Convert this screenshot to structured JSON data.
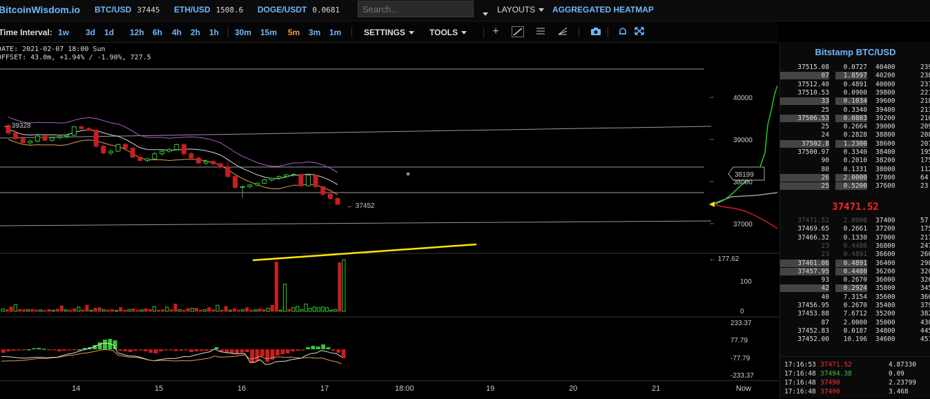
{
  "header": {
    "brand": "BitcoinWisdom.io",
    "tickers": [
      {
        "symbol": "BTC/USD",
        "value": "37445"
      },
      {
        "symbol": "ETH/USD",
        "value": "1508.6"
      },
      {
        "symbol": "DOGE/USDT",
        "value": "0.0681"
      }
    ],
    "search_placeholder": "Search...",
    "layouts_label": "LAYOUTS",
    "heatmap_label": "AGGREGATED HEATMAP"
  },
  "toolbar": {
    "time_interval_label": "Time Interval:",
    "intervals": [
      {
        "label": "1w",
        "active": false
      },
      {
        "label": "3d",
        "active": false
      },
      {
        "label": "1d",
        "active": false
      },
      {
        "label": "12h",
        "active": false
      },
      {
        "label": "6h",
        "active": false
      },
      {
        "label": "4h",
        "active": false
      },
      {
        "label": "2h",
        "active": false
      },
      {
        "label": "1h",
        "active": false
      },
      {
        "label": "30m",
        "active": false
      },
      {
        "label": "15m",
        "active": false
      },
      {
        "label": "5m",
        "active": true
      },
      {
        "label": "3m",
        "active": false
      },
      {
        "label": "1m",
        "active": false
      }
    ],
    "settings_label": "SETTINGS",
    "tools_label": "TOOLS"
  },
  "info": {
    "date_line": "DATE: 2021-02-07 18:00 Sun",
    "offset_line": "OFFSET: 43.0m, +1.94% / -1.90%, 727.5"
  },
  "chart_data": {
    "type": "candlestick",
    "price_axis_ticks": [
      "40000",
      "39000",
      "38000",
      "37000"
    ],
    "annotations": {
      "high_marker": "39328",
      "last_marker": "37452",
      "depth_price_box": "38199",
      "volume_peak": "177.62"
    },
    "volume_axis_ticks": [
      "100",
      "0"
    ],
    "macd_axis_ticks": [
      "233.37",
      "77.79",
      "-77.79",
      "-233.37"
    ],
    "x_axis_labels": [
      "14",
      "15",
      "16",
      "17",
      "18:00",
      "19",
      "20",
      "21",
      "Now"
    ],
    "candles": [
      {
        "o": 39330,
        "h": 39380,
        "l": 39120,
        "c": 39150
      },
      {
        "o": 39150,
        "h": 39220,
        "l": 38980,
        "c": 39020
      },
      {
        "o": 39020,
        "h": 39080,
        "l": 38880,
        "c": 38920
      },
      {
        "o": 38920,
        "h": 39000,
        "l": 38850,
        "c": 38960
      },
      {
        "o": 38960,
        "h": 39120,
        "l": 38930,
        "c": 39080
      },
      {
        "o": 39080,
        "h": 39150,
        "l": 38950,
        "c": 38980
      },
      {
        "o": 38980,
        "h": 39060,
        "l": 38940,
        "c": 39040
      },
      {
        "o": 39040,
        "h": 39100,
        "l": 39000,
        "c": 39070
      },
      {
        "o": 39070,
        "h": 39120,
        "l": 39020,
        "c": 39100
      },
      {
        "o": 39100,
        "h": 39320,
        "l": 39080,
        "c": 39300
      },
      {
        "o": 39300,
        "h": 39340,
        "l": 39220,
        "c": 39260
      },
      {
        "o": 39260,
        "h": 39300,
        "l": 39200,
        "c": 39220
      },
      {
        "o": 39220,
        "h": 39240,
        "l": 38800,
        "c": 38840
      },
      {
        "o": 38840,
        "h": 38880,
        "l": 38640,
        "c": 38680
      },
      {
        "o": 38680,
        "h": 38760,
        "l": 38620,
        "c": 38720
      },
      {
        "o": 38720,
        "h": 38900,
        "l": 38700,
        "c": 38880
      },
      {
        "o": 38880,
        "h": 38920,
        "l": 38760,
        "c": 38790
      },
      {
        "o": 38790,
        "h": 38820,
        "l": 38560,
        "c": 38580
      },
      {
        "o": 38580,
        "h": 38640,
        "l": 38480,
        "c": 38500
      },
      {
        "o": 38500,
        "h": 38560,
        "l": 38460,
        "c": 38540
      },
      {
        "o": 38540,
        "h": 38700,
        "l": 38520,
        "c": 38660
      },
      {
        "o": 38660,
        "h": 38760,
        "l": 38620,
        "c": 38720
      },
      {
        "o": 38720,
        "h": 38800,
        "l": 38680,
        "c": 38760
      },
      {
        "o": 38760,
        "h": 38900,
        "l": 38740,
        "c": 38880
      },
      {
        "o": 38880,
        "h": 38900,
        "l": 38620,
        "c": 38660
      },
      {
        "o": 38660,
        "h": 38700,
        "l": 38520,
        "c": 38560
      },
      {
        "o": 38560,
        "h": 38600,
        "l": 38420,
        "c": 38440
      },
      {
        "o": 38440,
        "h": 38520,
        "l": 38400,
        "c": 38480
      },
      {
        "o": 38480,
        "h": 38520,
        "l": 38380,
        "c": 38420
      },
      {
        "o": 38420,
        "h": 38460,
        "l": 38300,
        "c": 38340
      },
      {
        "o": 38340,
        "h": 38480,
        "l": 38080,
        "c": 38120
      },
      {
        "o": 38120,
        "h": 38160,
        "l": 37820,
        "c": 37860
      },
      {
        "o": 37860,
        "h": 37900,
        "l": 37620,
        "c": 37880
      },
      {
        "o": 37880,
        "h": 37940,
        "l": 37840,
        "c": 37920
      },
      {
        "o": 37920,
        "h": 37980,
        "l": 37880,
        "c": 37960
      },
      {
        "o": 37960,
        "h": 38060,
        "l": 37940,
        "c": 38040
      },
      {
        "o": 38040,
        "h": 38100,
        "l": 38000,
        "c": 38080
      },
      {
        "o": 38080,
        "h": 38140,
        "l": 38040,
        "c": 38120
      },
      {
        "o": 38120,
        "h": 38180,
        "l": 38080,
        "c": 38160
      },
      {
        "o": 38160,
        "h": 38200,
        "l": 38120,
        "c": 38170
      },
      {
        "o": 38170,
        "h": 38180,
        "l": 37860,
        "c": 37900
      },
      {
        "o": 37900,
        "h": 38180,
        "l": 37880,
        "c": 38150
      },
      {
        "o": 38150,
        "h": 38160,
        "l": 37840,
        "c": 37880
      },
      {
        "o": 37880,
        "h": 37900,
        "l": 37660,
        "c": 37700
      },
      {
        "o": 37700,
        "h": 37720,
        "l": 37560,
        "c": 37600
      },
      {
        "o": 37600,
        "h": 37620,
        "l": 37440,
        "c": 37460
      }
    ],
    "volume": [
      8,
      5,
      14,
      22,
      6,
      5,
      6,
      6,
      4,
      5,
      3,
      6,
      4,
      7,
      18,
      5,
      4,
      8,
      14,
      5,
      20,
      4,
      10,
      12,
      6,
      4,
      6,
      3,
      12,
      4,
      6,
      8,
      4,
      5,
      8,
      6,
      16,
      4,
      5,
      14,
      5,
      24,
      6,
      4,
      9,
      10,
      10,
      4,
      6,
      12,
      5,
      20,
      4,
      16,
      4,
      8,
      4,
      6,
      12,
      4,
      5,
      8,
      6,
      10,
      20,
      162,
      4,
      90,
      6,
      12,
      16,
      6,
      24,
      10,
      14,
      12,
      14,
      12,
      4,
      6,
      160,
      170
    ],
    "macd_hist": [
      -10,
      -6,
      -4,
      -3,
      -2,
      0,
      3,
      4,
      2,
      -2,
      -3,
      -6,
      -4,
      -2,
      -3,
      0,
      4,
      6,
      12,
      20,
      28,
      30,
      26,
      -4,
      -6,
      -8,
      -4,
      -3,
      -6,
      -10,
      -12,
      -6,
      -3,
      -2,
      -5,
      -4,
      -3,
      -8,
      -6,
      -5,
      -4,
      -3,
      6,
      -6,
      -10,
      -12,
      -14,
      -10,
      -8,
      -40,
      -34,
      -20,
      -36,
      -30,
      -18,
      -14,
      -12,
      -6,
      -4,
      -3,
      6,
      10,
      8,
      14,
      6,
      -4,
      -10,
      -26
    ]
  },
  "orderbook": {
    "title": "Bitstamp BTC/USD",
    "mid_price": "37471.52",
    "asks": [
      {
        "price": "37515.08",
        "amount": "0.0727",
        "level": "40400",
        "cum": "239"
      },
      {
        "price": "07",
        "amount": "1.8597",
        "level": "40200",
        "cum": "238",
        "hl": true
      },
      {
        "price": "37512.40",
        "amount": "0.4891",
        "level": "40000",
        "cum": "237"
      },
      {
        "price": "37510.53",
        "amount": "0.0900",
        "level": "39800",
        "cum": "221"
      },
      {
        "price": "33",
        "amount": "0.1034",
        "level": "39600",
        "cum": "218",
        "hl": true
      },
      {
        "price": "25",
        "amount": "0.3340",
        "level": "39400",
        "cum": "213"
      },
      {
        "price": "37506.53",
        "amount": "0.0803",
        "level": "39200",
        "cum": "210",
        "hl": true
      },
      {
        "price": "25",
        "amount": "0.2664",
        "level": "39000",
        "cum": "209"
      },
      {
        "price": "24",
        "amount": "0.2828",
        "level": "38800",
        "cum": "208"
      },
      {
        "price": "37502.8",
        "amount": "1.2300",
        "level": "38600",
        "cum": "207",
        "hl": true
      },
      {
        "price": "37500.97",
        "amount": "0.3340",
        "level": "38400",
        "cum": "195"
      },
      {
        "price": "90",
        "amount": "0.2010",
        "level": "38200",
        "cum": "175"
      },
      {
        "price": "80",
        "amount": "0.1331",
        "level": "38000",
        "cum": "112"
      },
      {
        "price": "26",
        "amount": "2.0000",
        "level": "37800",
        "cum": "64",
        "hl": true
      },
      {
        "price": "25",
        "amount": "0.5200",
        "level": "37600",
        "cum": "23",
        "hl": true
      }
    ],
    "bids": [
      {
        "price": "37471.52",
        "amount": "2.0000",
        "level": "37400",
        "cum": "57",
        "dim": true
      },
      {
        "price": "37469.65",
        "amount": "0.2661",
        "level": "37200",
        "cum": "175"
      },
      {
        "price": "37466.32",
        "amount": "0.1330",
        "level": "37000",
        "cum": "217"
      },
      {
        "price": "23",
        "amount": "0.4480",
        "level": "36800",
        "cum": "247",
        "dim": true
      },
      {
        "price": "23",
        "amount": "0.4891",
        "level": "36600",
        "cum": "260",
        "dim": true
      },
      {
        "price": "37461.06",
        "amount": "0.4891",
        "level": "36400",
        "cum": "298",
        "hl": true
      },
      {
        "price": "37457.95",
        "amount": "0.4480",
        "level": "36200",
        "cum": "320",
        "hl": true
      },
      {
        "price": "93",
        "amount": "0.2670",
        "level": "36000",
        "cum": "326"
      },
      {
        "price": "42",
        "amount": "0.2924",
        "level": "35800",
        "cum": "345",
        "hl": true
      },
      {
        "price": "40",
        "amount": "7.3154",
        "level": "35600",
        "cum": "360"
      },
      {
        "price": "37456.95",
        "amount": "0.2670",
        "level": "35400",
        "cum": "379"
      },
      {
        "price": "37453.88",
        "amount": "7.6712",
        "level": "35200",
        "cum": "382"
      },
      {
        "price": "87",
        "amount": "2.0000",
        "level": "35000",
        "cum": "430"
      },
      {
        "price": "37452.83",
        "amount": "0.0187",
        "level": "34800",
        "cum": "445"
      },
      {
        "price": "37452.00",
        "amount": "10.196",
        "level": "34600",
        "cum": "451"
      }
    ],
    "trades": [
      {
        "time": "17:16:53",
        "price": "37471.52",
        "amount": "4.87330",
        "side": "sell"
      },
      {
        "time": "17:16:48",
        "price": "37494.38",
        "amount": "0.09",
        "side": "buy"
      },
      {
        "time": "17:16:48",
        "price": "37490",
        "amount": "2.23799",
        "side": "sell"
      },
      {
        "time": "17:16:48",
        "price": "37490",
        "amount": "3.468",
        "side": "sell"
      }
    ]
  },
  "colors": {
    "accent": "#6fb7ff",
    "up": "#34c934",
    "down": "#c81e1e",
    "highlight": "#f0a040"
  }
}
